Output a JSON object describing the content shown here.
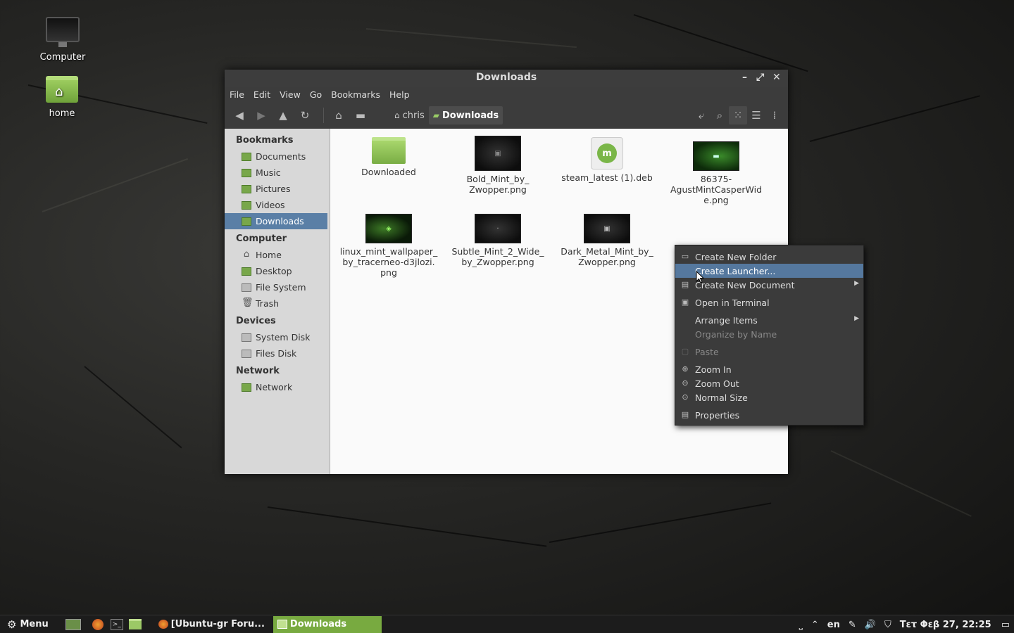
{
  "desktop": {
    "icons": [
      {
        "label": "Computer"
      },
      {
        "label": "home"
      }
    ]
  },
  "window": {
    "title": "Downloads",
    "controls": {
      "minimize": "–",
      "maximize": "⤢",
      "close": "✕"
    },
    "menus": [
      "File",
      "Edit",
      "View",
      "Go",
      "Bookmarks",
      "Help"
    ],
    "breadcrumb": [
      {
        "label": "chris"
      },
      {
        "label": "Downloads"
      }
    ]
  },
  "sidebar": {
    "sections": [
      {
        "heading": "Bookmarks",
        "items": [
          "Documents",
          "Music",
          "Pictures",
          "Videos",
          "Downloads"
        ]
      },
      {
        "heading": "Computer",
        "items": [
          "Home",
          "Desktop",
          "File System",
          "Trash"
        ]
      },
      {
        "heading": "Devices",
        "items": [
          "System Disk",
          "Files Disk"
        ]
      },
      {
        "heading": "Network",
        "items": [
          "Network"
        ]
      }
    ],
    "selected": "Downloads"
  },
  "files": [
    {
      "name": "Downloaded",
      "lines": [
        "Downloaded"
      ],
      "type": "folder"
    },
    {
      "name": "Bold_Mint_by_Zwopper.png",
      "lines": [
        "Bold_Mint_by_",
        "Zwopper.png"
      ],
      "type": "image-dark"
    },
    {
      "name": "steam_latest (1).deb",
      "lines": [
        "steam_latest (1).deb"
      ],
      "type": "deb"
    },
    {
      "name": "86375-AgustMintCasperWide.png",
      "lines": [
        "86375-",
        "AgustMintCasperWid",
        "e.png"
      ],
      "type": "image-green"
    },
    {
      "name": "linux_mint_wallpaper_by_tracerneo-d3jlozi.png",
      "lines": [
        "linux_mint_wallpaper_",
        "by_tracerneo-d3jlozi.",
        "png"
      ],
      "type": "image-linux"
    },
    {
      "name": "Subtle_Mint_2_Wide_by_Zwopper.png",
      "lines": [
        "Subtle_Mint_2_Wide_",
        "by_Zwopper.png"
      ],
      "type": "image-subtle"
    },
    {
      "name": "Dark_Metal_Mint_by_Zwopper.png",
      "lines": [
        "Dark_Metal_Mint_by_",
        "Zwopper.png"
      ],
      "type": "image-dark"
    }
  ],
  "context_menu": {
    "items": [
      {
        "label": "Create New Folder",
        "icon": "folder-icon"
      },
      {
        "label": "Create Launcher...",
        "highlighted": true
      },
      {
        "label": "Create New Document",
        "icon": "document-icon",
        "submenu": true
      },
      {
        "label": "Open in Terminal",
        "icon": "terminal-icon"
      },
      {
        "label": "Arrange Items",
        "submenu": true
      },
      {
        "label": "Organize by Name",
        "disabled": true
      },
      {
        "label": "Paste",
        "icon": "paste-icon",
        "disabled": true
      },
      {
        "label": "Zoom In",
        "icon": "zoom-in-icon"
      },
      {
        "label": "Zoom Out",
        "icon": "zoom-out-icon"
      },
      {
        "label": "Normal Size",
        "icon": "zoom-normal-icon"
      },
      {
        "label": "Properties",
        "icon": "properties-icon"
      }
    ]
  },
  "taskbar": {
    "menu_label": "Menu",
    "tasks": [
      {
        "label": "[Ubuntu-gr Foru..."
      },
      {
        "label": "Downloads",
        "active": true
      }
    ],
    "tray": {
      "language": "en",
      "clock": "Τετ Φεβ 27, 22:25"
    }
  },
  "colors": {
    "accent_selection": "#5a7fa6",
    "task_active": "#78aa40",
    "menu_highlight": "#55789e"
  }
}
